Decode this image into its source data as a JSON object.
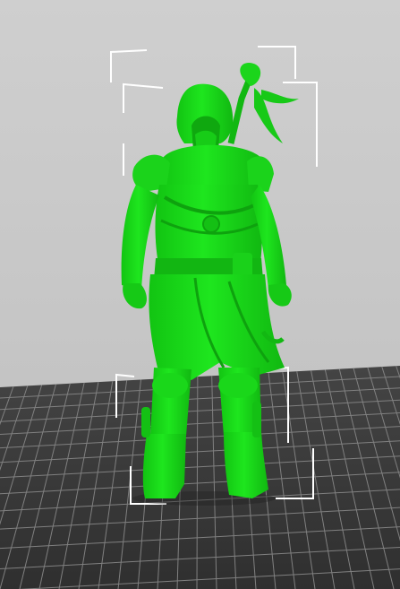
{
  "viewport": {
    "background_color": "#c9c9c9",
    "build_plate_color": "#3a3a3a",
    "grid_line_color": "#7a7a7a",
    "bounding_box_color": "#ffffff",
    "model_color": "#19e619",
    "model_shadow_color": "#0ea10e"
  },
  "model": {
    "icon": "hooded-figure-model"
  }
}
